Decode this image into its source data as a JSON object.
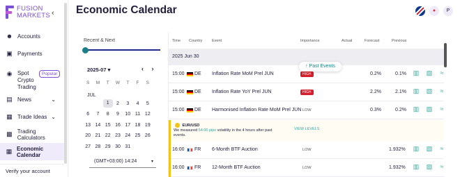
{
  "brand": {
    "line1": "FUSION",
    "line2": "MARKETS"
  },
  "sidebar": {
    "collapse_icon": "‹",
    "items": [
      {
        "label": "Accounts",
        "icon": "user-icon"
      },
      {
        "label": "Payments",
        "icon": "wallet-icon"
      },
      {
        "label": "Spot\nCrypto\nTrading",
        "line1": "Spot",
        "line2": "Crypto",
        "line3": "Trading",
        "badge": "Popular",
        "icon": "coin-icon"
      },
      {
        "label": "News",
        "icon": "news-icon",
        "chevron": "⌄"
      },
      {
        "label": "Trade Ideas",
        "icon": "ideas-icon",
        "chevron": "⌄"
      },
      {
        "label": "Trading Calculators",
        "icon": "calculator-icon"
      },
      {
        "label": "Economic Calendar",
        "icon": "calendar-icon",
        "active": true
      }
    ],
    "verify": "Verify your account"
  },
  "header": {
    "title": "Economic Calendar",
    "avatar": "P"
  },
  "calendar": {
    "range_label": "Recent & Next",
    "month": "2025-07",
    "month_caret": "▾",
    "prev": "‹",
    "next": "›",
    "weekdays": [
      "S",
      "M",
      "T",
      "W",
      "T",
      "F",
      "S"
    ],
    "month_label": "JUL",
    "weeks": [
      [
        "",
        "",
        "1",
        "2",
        "3",
        "4",
        "5"
      ],
      [
        "6",
        "7",
        "8",
        "9",
        "10",
        "11",
        "12"
      ],
      [
        "13",
        "14",
        "15",
        "16",
        "17",
        "18",
        "19"
      ],
      [
        "20",
        "21",
        "22",
        "23",
        "24",
        "25",
        "26"
      ],
      [
        "27",
        "28",
        "29",
        "30",
        "31",
        "",
        ""
      ]
    ],
    "timezone": "(GMT+03:00) 14:24",
    "tz_caret": "▾"
  },
  "table": {
    "headers": {
      "time": "Time",
      "country": "Country",
      "event": "Event",
      "importance": "Importance",
      "actual": "Actual",
      "forecast": "Forecast",
      "previous": "Previous"
    },
    "group_date": "2025 Jun 30",
    "past_events_button": "↑  Past Events",
    "rows": [
      {
        "time": "15:00",
        "country": "DE",
        "event": "Inflation Rate MoM Prel JUN",
        "importance": "HIGH",
        "actual": "",
        "forecast": "0.2%",
        "previous": "0.1%"
      },
      {
        "time": "15:00",
        "country": "DE",
        "event": "Inflation Rate YoY Prel JUN",
        "importance": "HIGH",
        "actual": "",
        "forecast": "2.2%",
        "previous": "2.1%"
      },
      {
        "time": "15:00",
        "country": "DE",
        "event": "Harmonised Inflation Rate MoM Prel JUN",
        "importance": "LOW",
        "actual": "",
        "forecast": "0.3%",
        "previous": "0.2%"
      },
      {
        "time": "16:00",
        "country": "FR",
        "event": "6-Month BTF Auction",
        "importance": "LOW",
        "actual": "",
        "forecast": "",
        "previous": "1.932%"
      },
      {
        "time": "16:00",
        "country": "FR",
        "event": "12-Month BTF Auction",
        "importance": "LOW",
        "actual": "",
        "forecast": "",
        "previous": "1.932%"
      }
    ],
    "promo": {
      "symbol": "EUR/USD",
      "msg_pre": "We measured ",
      "msg_hl": "54.00 pips",
      "msg_post": " volatility in the 4 hours after past events.",
      "view": "VIEW LEVELS"
    }
  }
}
